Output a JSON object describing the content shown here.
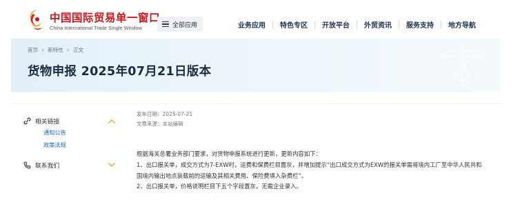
{
  "header": {
    "logo_cn": "中国国际贸易单一窗口",
    "logo_en": "China International Trade Single Window",
    "all_apps_label": "全部应用",
    "nav": [
      "业务应用",
      "特色专区",
      "开放平台",
      "外贸资讯",
      "服务支持",
      "地方导航"
    ]
  },
  "banner": {
    "breadcrumb": [
      "首页",
      "新特性",
      "正文"
    ],
    "breadcrumb_sep": "»",
    "title": "货物申报 2025年07月21日版本"
  },
  "sidebar": {
    "groups": [
      {
        "label": "相关链接",
        "icon": "link-icon",
        "expanded": true,
        "links": [
          "通知公告",
          "政策法规"
        ]
      },
      {
        "label": "联系我们",
        "icon": "phone-icon",
        "expanded": false,
        "links": []
      }
    ]
  },
  "article": {
    "publish_date": "发布日期：2025-07-21",
    "source": "文章来源：本站编辑",
    "paragraphs": [
      "根据海关总署业务部门要求，对货物申报系统进行更新，更新内容如下：",
      "1、出口报关单，成交方式为7-EXW时，运费和保费栏目置灰，并增加提示“出口成交方式为EXW的报关单需将境内工厂至中华人民共和",
      "国境内输出地点装载前的运输及其相关费用、保险费填入杂费栏”。",
      "2、出口报关单，价格说明栏目下五个字段置灰，无需企业录入。"
    ]
  },
  "colors": {
    "brand_red": "#c8161d",
    "nav_text": "#1f3350",
    "link_blue": "#2266c4",
    "accent_orange": "#f0a020"
  }
}
